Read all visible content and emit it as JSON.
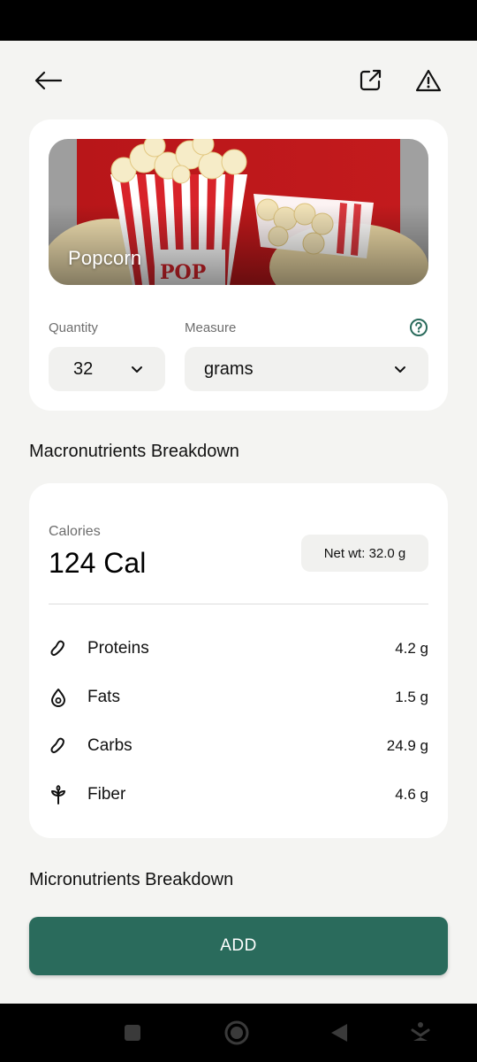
{
  "food": {
    "name": "Popcorn",
    "image_icon": "popcorn-image"
  },
  "quantity": {
    "label": "Quantity",
    "value": "32"
  },
  "measure": {
    "label": "Measure",
    "value": "grams"
  },
  "macros": {
    "section_title": "Macronutrients Breakdown",
    "calories_label": "Calories",
    "calories_value": "124 Cal",
    "net_weight": "Net wt: 32.0 g",
    "items": [
      {
        "name": "Proteins",
        "value": "4.2 g",
        "icon": "bean-icon"
      },
      {
        "name": "Fats",
        "value": "1.5 g",
        "icon": "drop-icon"
      },
      {
        "name": "Carbs",
        "value": "24.9 g",
        "icon": "bean-icon"
      },
      {
        "name": "Fiber",
        "value": "4.6 g",
        "icon": "sprout-icon"
      }
    ]
  },
  "micros": {
    "section_title": "Micronutrients Breakdown"
  },
  "add_button": {
    "label": "ADD"
  },
  "colors": {
    "accent": "#2a6b5c",
    "background": "#f4f4f2",
    "card": "#ffffff"
  }
}
